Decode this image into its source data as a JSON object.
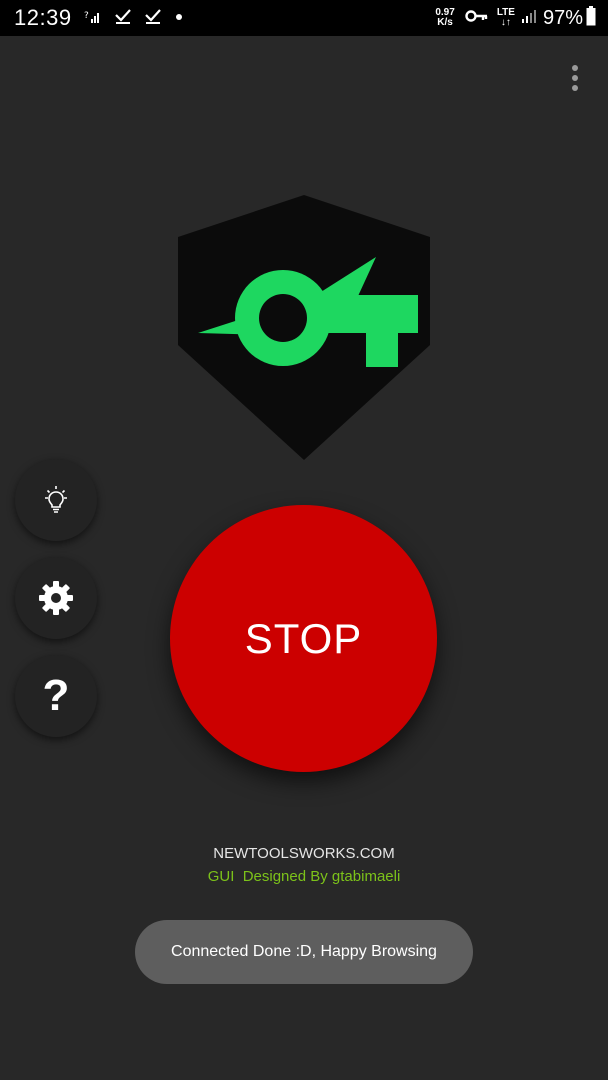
{
  "status_bar": {
    "time": "12:39",
    "net_speed_value": "0.97",
    "net_speed_unit": "K/s",
    "network_type": "LTE",
    "battery": "97%"
  },
  "icons": {
    "menu": "more-vert-icon",
    "bulb": "lightbulb-icon",
    "settings": "gear-icon",
    "help": "help-icon"
  },
  "side_buttons": {
    "help_glyph": "?"
  },
  "main": {
    "stop_label": "STOP",
    "site": "NEWTOOLSWORKS.COM",
    "credit": "GUI  Designed By gtabimaeli"
  },
  "toast": {
    "message": "Connected Done :D, Happy Browsing"
  },
  "colors": {
    "background": "#282828",
    "stop_button": "#cc0000",
    "logo_green": "#1ed760",
    "logo_shield": "#0b0b0b",
    "credit_text": "#7cc21a"
  }
}
